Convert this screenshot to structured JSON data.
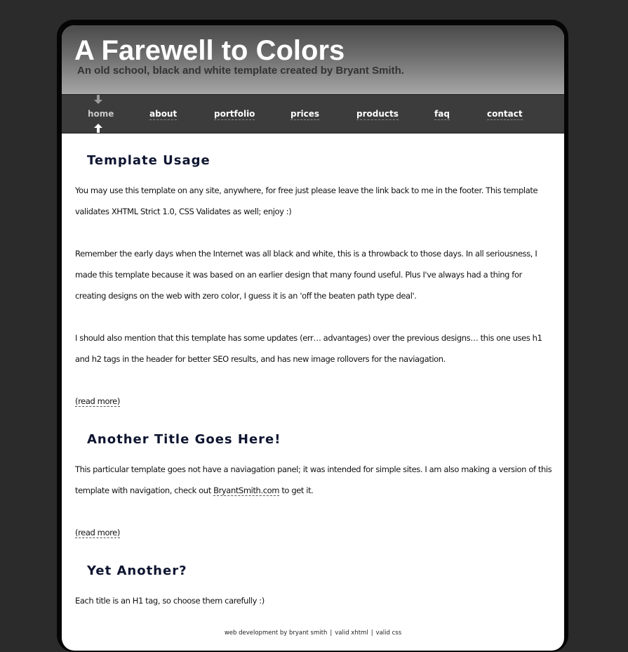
{
  "header": {
    "title": "A Farewell to Colors",
    "subtitle": "An old school, black and white template created by Bryant Smith."
  },
  "nav": {
    "items": [
      {
        "label": "home"
      },
      {
        "label": "about"
      },
      {
        "label": "portfolio"
      },
      {
        "label": "prices"
      },
      {
        "label": "products"
      },
      {
        "label": "faq"
      },
      {
        "label": "contact"
      }
    ],
    "active": "home"
  },
  "sections": [
    {
      "title": "Template Usage",
      "paragraphs": [
        "You may use this template on any site, anywhere, for free just please leave the link back to me in the footer. This template validates XHTML Strict 1.0, CSS Validates as well; enjoy :)",
        "Remember the early days when the Internet was all black and white, this is a throwback to those days. In all seriousness, I made this template because it was based on an earlier design that many found useful. Plus I've always had a thing for creating designs on the web with zero color, I guess it is an 'off the beaten path type deal'.",
        "I should also mention that this template has some updates (err… advantages) over the previous designs… this one uses h1 and h2 tags in the header for better SEO results, and has new image rollovers for the naviagation."
      ],
      "read_more": "(read more)"
    },
    {
      "title": "Another Title Goes Here!",
      "paragraph_before_link": "This particular template goes not have a naviagation panel; it was intended for simple sites. I am also making a version of this template with navigation, check out",
      "link": "BryantSmith.com",
      "paragraph_after_link": "to get it.",
      "read_more": "(read more)"
    },
    {
      "title": "Yet Another?",
      "paragraph": "Each title is an H1 tag, so choose them carefully :)"
    }
  ],
  "footer": {
    "credit": "web development by bryant smith",
    "separator": "|",
    "valid_xhtml": "valid xhtml",
    "valid_css": "valid css"
  },
  "colors": {
    "background": "#2b2b2b",
    "frame": "#050505",
    "nav": "#3c3c3c",
    "heading": "#0e1530"
  }
}
